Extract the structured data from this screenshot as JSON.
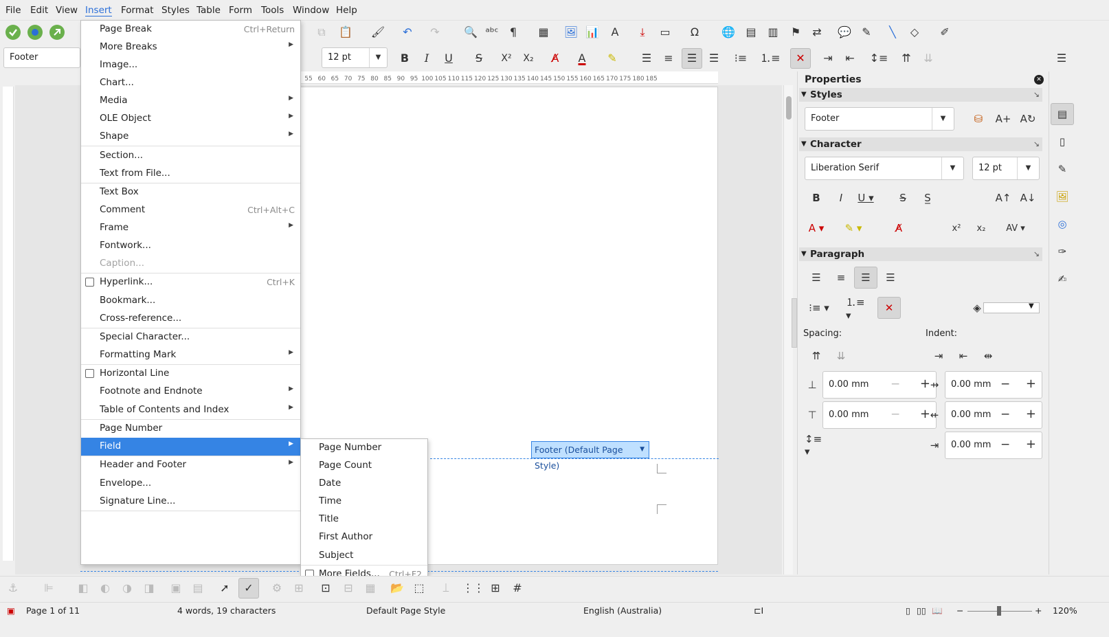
{
  "menubar": [
    "File",
    "Edit",
    "View",
    "Insert",
    "Format",
    "Styles",
    "Table",
    "Form",
    "Tools",
    "Window",
    "Help"
  ],
  "toolbar": {
    "paragraph_style": "Footer",
    "font_name": "Liberation Serif",
    "font_size": "12 pt"
  },
  "ruler_ticks": [
    "55",
    "60",
    "65",
    "70",
    "75",
    "80",
    "85",
    "90",
    "95",
    "100",
    "105",
    "110",
    "115",
    "120",
    "125",
    "130",
    "135",
    "140",
    "145",
    "150",
    "155",
    "160",
    "165",
    "170",
    "175",
    "180",
    "185"
  ],
  "insert_menu": [
    {
      "label": "Page Break",
      "shortcut": "Ctrl+Return"
    },
    {
      "label": "More Breaks",
      "submenu": true
    },
    {
      "label": "Image..."
    },
    {
      "label": "Chart..."
    },
    {
      "label": "Media",
      "submenu": true
    },
    {
      "label": "OLE Object",
      "submenu": true
    },
    {
      "label": "Shape",
      "submenu": true
    },
    {
      "label": "Section..."
    },
    {
      "label": "Text from File..."
    },
    {
      "label": "Text Box"
    },
    {
      "label": "Comment",
      "shortcut": "Ctrl+Alt+C"
    },
    {
      "label": "Frame",
      "submenu": true
    },
    {
      "label": "Fontwork..."
    },
    {
      "label": "Caption...",
      "disabled": true
    },
    {
      "label": "Hyperlink...",
      "shortcut": "Ctrl+K",
      "checkbox": true
    },
    {
      "label": "Bookmark..."
    },
    {
      "label": "Cross-reference..."
    },
    {
      "label": "Special Character..."
    },
    {
      "label": "Formatting Mark",
      "submenu": true
    },
    {
      "label": "Horizontal Line",
      "checkbox": true
    },
    {
      "label": "Footnote and Endnote",
      "submenu": true
    },
    {
      "label": "Table of Contents and Index",
      "submenu": true
    },
    {
      "label": "Page Number"
    },
    {
      "label": "Field",
      "submenu": true,
      "highlighted": true
    },
    {
      "label": "Header and Footer",
      "submenu": true
    },
    {
      "label": "Envelope..."
    },
    {
      "label": "Signature Line..."
    }
  ],
  "field_submenu": [
    {
      "label": "Page Number"
    },
    {
      "label": "Page Count"
    },
    {
      "label": "Date"
    },
    {
      "label": "Time"
    },
    {
      "label": "Title"
    },
    {
      "label": "First Author"
    },
    {
      "label": "Subject"
    },
    {
      "label": "More Fields...",
      "shortcut": "Ctrl+F2",
      "checkbox": true
    }
  ],
  "footer_tag": "Footer (Default Page Style)",
  "sidebar": {
    "title": "Properties",
    "styles_head": "Styles",
    "style_value": "Footer",
    "character_head": "Character",
    "font_value": "Liberation Serif",
    "size_value": "12 pt",
    "paragraph_head": "Paragraph",
    "spacing_label": "Spacing:",
    "indent_label": "Indent:",
    "above_value": "0.00 mm",
    "below_value": "0.00 mm",
    "indent_before": "0.00 mm",
    "indent_after": "0.00 mm",
    "first_line": "0.00 mm"
  },
  "status": {
    "page": "Page 1 of 11",
    "words": "4 words, 19 characters",
    "page_style": "Default Page Style",
    "language": "English (Australia)",
    "zoom": "120%"
  },
  "colors": {
    "accent": "#3584e4",
    "font_color": "#cc0000",
    "highlight": "#ffee00",
    "footer_tag": "#bfe0ff"
  }
}
